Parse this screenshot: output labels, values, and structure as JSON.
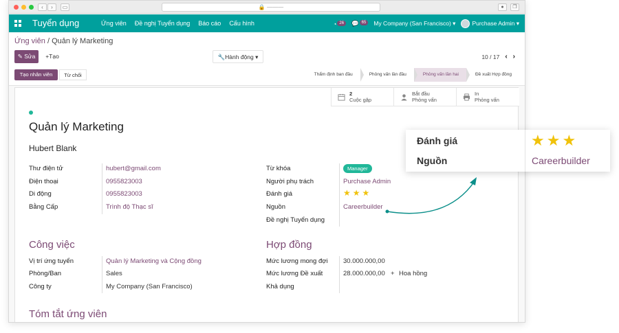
{
  "browser": {
    "url_placeholder": "———",
    "nav_back": "‹",
    "nav_forward": "›"
  },
  "topnav": {
    "brand": "Tuyển dụng",
    "menu": [
      "Ứng viên",
      "Đề nghị Tuyển dụng",
      "Báo cáo",
      "Cấu hình"
    ],
    "activity_count": "26",
    "messages_count": "65",
    "company": "My Company (San Francisco)",
    "user": "Purchase Admin",
    "accent": "#00a09d"
  },
  "control": {
    "breadcrumb_parent": "Ứng viên",
    "breadcrumb_sep": "/",
    "breadcrumb_current": "Quản lý Marketing",
    "edit_label": "Sửa",
    "create_label": "Tạo",
    "action_label": "Hành động",
    "pager": "10 / 17"
  },
  "status": {
    "hire_label": "Tạo nhân viên",
    "refuse_label": "Từ chối",
    "stages": [
      "Thẩm định ban đầu",
      "Phỏng vấn lần đầu",
      "Phỏng vấn lần hai",
      "Đề xuất Hợp đồng"
    ],
    "active_stage": "Phỏng vấn lần hai"
  },
  "smart_buttons": {
    "meetings_count": "2",
    "meetings_label": "Cuộc gặp",
    "start_line1": "Bắt đầu",
    "start_line2": "Phỏng vấn",
    "print_line1": "In",
    "print_line2": "Phỏng vấn"
  },
  "form": {
    "title": "Quản lý Marketing",
    "partner": "Hubert Blank",
    "left_fields": [
      {
        "label": "Thư điện tử",
        "value": "hubert@gmail.com"
      },
      {
        "label": "Điện thoại",
        "value": "0955823003"
      },
      {
        "label": "Di động",
        "value": "0955823003"
      },
      {
        "label": "Bằng Cấp",
        "value": "Trình độ Thạc sĩ"
      }
    ],
    "right_fields": [
      {
        "label": "Từ khóa",
        "value": "Manager"
      },
      {
        "label": "Người phụ trách",
        "value": "Purchase Admin"
      },
      {
        "label": "Đánh giá",
        "value": 3
      },
      {
        "label": "Nguồn",
        "value": "Careerbuilder"
      },
      {
        "label": "Đề nghị Tuyển dụng",
        "value": ""
      }
    ],
    "job_section": "Công việc",
    "job_fields": [
      {
        "label": "Vị trí ứng tuyển",
        "value": "Quản lý Marketing và Cộng đồng"
      },
      {
        "label": "Phòng/Ban",
        "value": "Sales"
      },
      {
        "label": "Công ty",
        "value": "My Company (San Francisco)"
      }
    ],
    "contract_section": "Hợp đồng",
    "contract_fields": [
      {
        "label": "Mức lương mong đợi",
        "value": "30.000.000,00"
      },
      {
        "label": "Mức lương Đề xuất",
        "value": "28.000.000,00",
        "plus": "+",
        "extra": "Hoa hồng"
      },
      {
        "label": "Khả dụng",
        "value": ""
      }
    ],
    "summary_section": "Tóm tắt ứng viên"
  },
  "zoom_popup": {
    "rating_label": "Đánh giá",
    "rating_stars": 3,
    "source_label": "Nguồn",
    "source_value": "Careerbuilder"
  },
  "colors": {
    "primary": "#7c4a74",
    "teal": "#00a09d",
    "star": "#f0c20b",
    "tag": "#21b799"
  }
}
